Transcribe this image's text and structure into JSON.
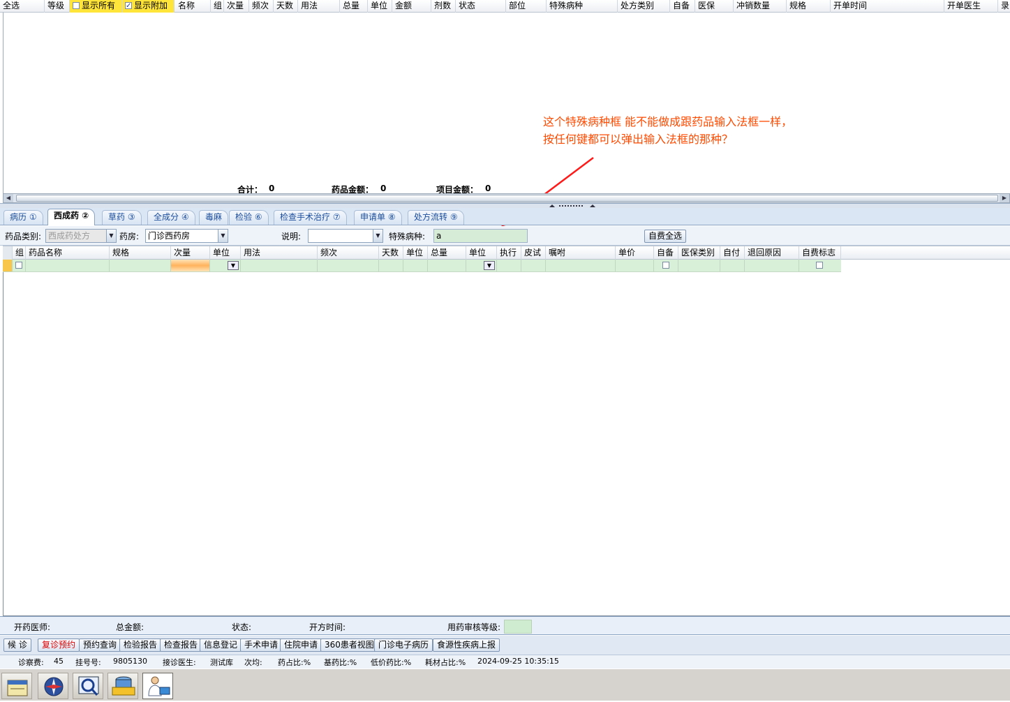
{
  "top_grid": {
    "headers": [
      "全选",
      "等级",
      "显示所有",
      "显示附加",
      "名称",
      "组",
      "次量",
      "频次",
      "天数",
      "用法",
      "总量",
      "单位",
      "金额",
      "剂数",
      "状态",
      "部位",
      "特殊病种",
      "处方类别",
      "自备",
      "医保",
      "冲销数量",
      "规格",
      "开单时间",
      "开单医生",
      "录"
    ],
    "totals": {
      "sum_label": "合计：",
      "sum_value": "0",
      "drug_label": "药品金额：",
      "drug_value": "0",
      "item_label": "项目金额：",
      "item_value": "0"
    }
  },
  "annotation": {
    "line1": "这个特殊病种框 能不能做成跟药品输入法框一样，",
    "line2": "按任何键都可以弹出输入法框的那种？"
  },
  "tabs": [
    "病历 ①",
    "西成药 ②",
    "草药 ③",
    "全成分 ④",
    "毒麻",
    "检验 ⑥",
    "检查手术治疗 ⑦",
    "申请单 ⑧",
    "处方流转 ⑨"
  ],
  "active_tab": 1,
  "filter": {
    "drug_category_label": "药品类别:",
    "drug_category_value": "西成药处方",
    "pharmacy_label": "药房:",
    "pharmacy_value": "门诊西药房",
    "note_label": "说明:",
    "note_value": "",
    "special_disease_label": "特殊病种:",
    "special_disease_value": "a",
    "self_pay_all_button": "自费全选"
  },
  "drug_grid": {
    "headers": [
      "组",
      "药品名称",
      "规格",
      "次量",
      "单位",
      "用法",
      "频次",
      "天数",
      "单位",
      "总量",
      "单位",
      "执行",
      "皮试",
      "嘱咐",
      "单价",
      "自备",
      "医保类别",
      "自付",
      "退回原因",
      "自费标志"
    ]
  },
  "info_bar": {
    "doctor_label": "开药医师:",
    "total_label": "总金额:",
    "status_label": "状态:",
    "time_label": "开方时间:",
    "audit_label": "用药审核等级:"
  },
  "action_buttons": [
    "候 诊",
    "复诊预约",
    "预约查询",
    "检验报告",
    "检查报告",
    "信息登记",
    "手术申请",
    "住院申请",
    "360患者视图",
    "门诊电子病历",
    "食源性疾病上报"
  ],
  "status_bar": {
    "fee_label": "诊察费:",
    "fee_value": "45",
    "reg_label": "挂号号:",
    "reg_value": "9805130",
    "doctor_label": "接诊医生:",
    "doctor_value": "测试库",
    "avg_label": "次均:",
    "drug_ratio": "药占比:%",
    "base_drug_ratio": "基药比:%",
    "low_price_ratio": "低价药比:%",
    "consumable_ratio": "耗材占比:%",
    "datetime": "2024-09-25 10:35:15"
  },
  "taskbar_icons": [
    "calendar-icon",
    "compass-icon",
    "sql-search-icon",
    "sql-database-icon",
    "doctor-icon"
  ]
}
